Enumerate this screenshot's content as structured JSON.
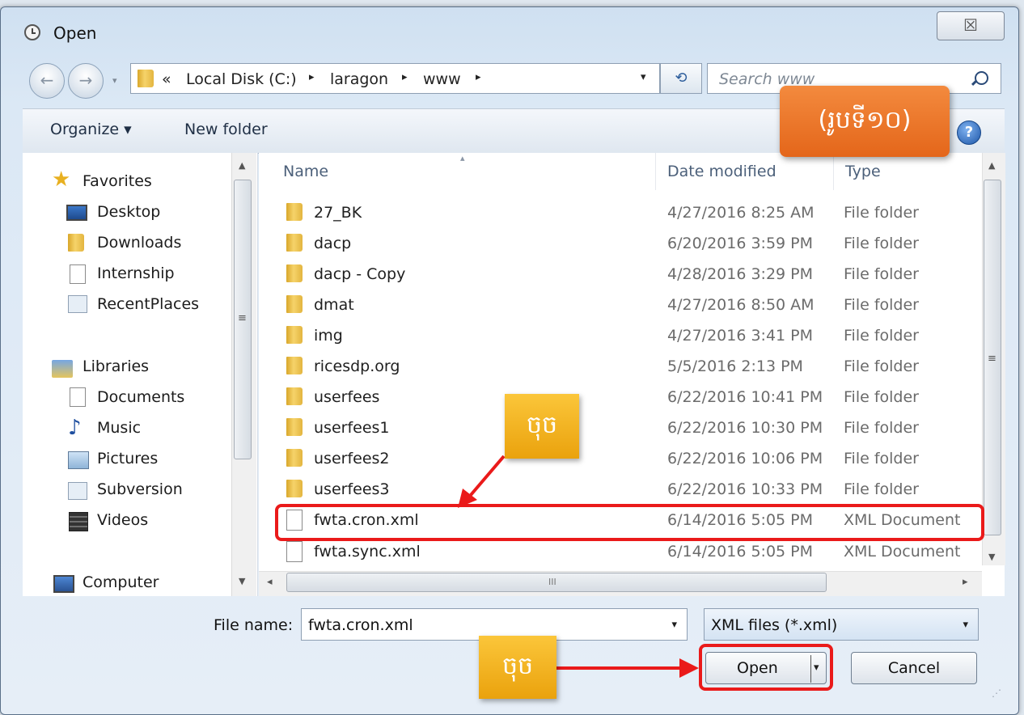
{
  "window": {
    "title": "Open",
    "close_glyph": "☒"
  },
  "nav": {
    "back_glyph": "←",
    "forward_glyph": "→",
    "recent_dropdown_glyph": "▾"
  },
  "address": {
    "overflow": "«",
    "crumbs": [
      "Local Disk (C:)",
      "laragon",
      "www"
    ],
    "separator": "▸",
    "dropdown_glyph": "▾"
  },
  "refresh_glyph": "⟲",
  "search": {
    "placeholder": "Search www"
  },
  "toolbar": {
    "organize": "Organize ▾",
    "new_folder": "New folder",
    "help_glyph": "?"
  },
  "sidebar": {
    "favorites": "Favorites",
    "desktop": "Desktop",
    "downloads": "Downloads",
    "internship": "Internship",
    "recent_places": "RecentPlaces",
    "libraries": "Libraries",
    "documents": "Documents",
    "music": "Music",
    "pictures": "Pictures",
    "subversion": "Subversion",
    "videos": "Videos",
    "computer": "Computer"
  },
  "columns": {
    "name": "Name",
    "date": "Date modified",
    "type": "Type"
  },
  "files": [
    {
      "name": "27_BK",
      "date": "4/27/2016 8:25 AM",
      "type": "File folder",
      "kind": "folder"
    },
    {
      "name": "dacp",
      "date": "6/20/2016 3:59 PM",
      "type": "File folder",
      "kind": "folder"
    },
    {
      "name": "dacp - Copy",
      "date": "4/28/2016 3:29 PM",
      "type": "File folder",
      "kind": "folder"
    },
    {
      "name": "dmat",
      "date": "4/27/2016 8:50 AM",
      "type": "File folder",
      "kind": "folder"
    },
    {
      "name": "img",
      "date": "4/27/2016 3:41 PM",
      "type": "File folder",
      "kind": "folder"
    },
    {
      "name": "ricesdp.org",
      "date": "5/5/2016 2:13 PM",
      "type": "File folder",
      "kind": "folder"
    },
    {
      "name": "userfees",
      "date": "6/22/2016 10:41 PM",
      "type": "File folder",
      "kind": "folder"
    },
    {
      "name": "userfees1",
      "date": "6/22/2016 10:30 PM",
      "type": "File folder",
      "kind": "folder"
    },
    {
      "name": "userfees2",
      "date": "6/22/2016 10:06 PM",
      "type": "File folder",
      "kind": "folder"
    },
    {
      "name": "userfees3",
      "date": "6/22/2016 10:33 PM",
      "type": "File folder",
      "kind": "folder"
    },
    {
      "name": "fwta.cron.xml",
      "date": "6/14/2016 5:05 PM",
      "type": "XML Document",
      "kind": "file"
    },
    {
      "name": "fwta.sync.xml",
      "date": "6/14/2016 5:05 PM",
      "type": "XML Document",
      "kind": "file"
    }
  ],
  "scroll_glyphs": {
    "up": "▲",
    "down": "▼",
    "left": "◂",
    "right": "▸",
    "grip_v": "≡",
    "grip_h": "III",
    "resize": "⋰"
  },
  "bottom": {
    "file_name_label": "File name:",
    "file_name_value": "fwta.cron.xml",
    "file_type": "XML files (*.xml)",
    "dropdown_glyph": "▾",
    "open": "Open",
    "open_dd": "▾",
    "cancel": "Cancel"
  },
  "annotations": {
    "figure_label": "(រូបទី១០)",
    "click_label_1": "ចុច",
    "click_label_2": "ចុច",
    "highlight_color": "#ea1a1a",
    "callout_color": "#f4b324",
    "figure_label_color": "#ec7632"
  }
}
